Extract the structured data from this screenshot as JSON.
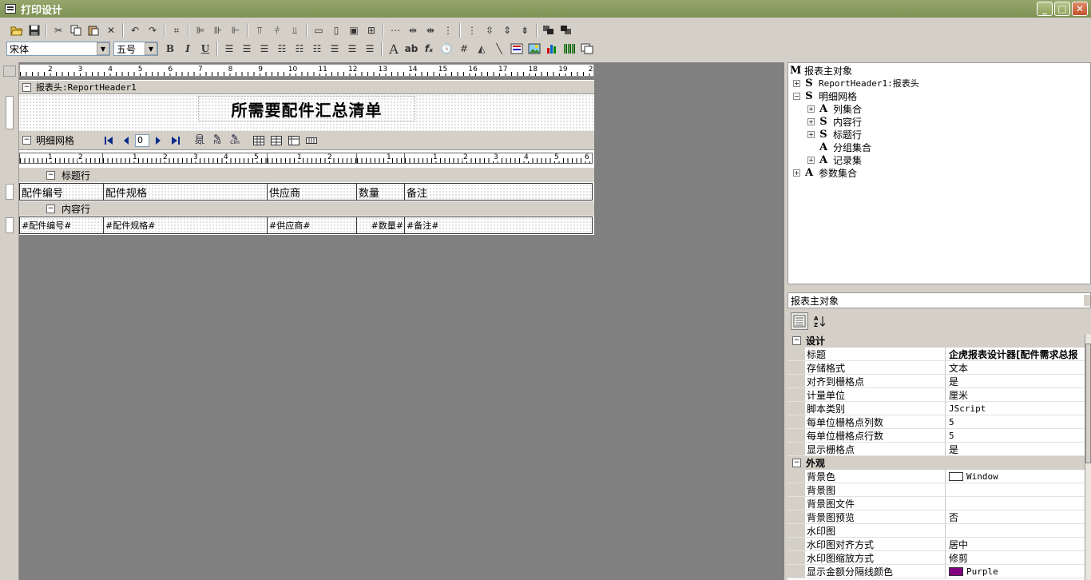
{
  "window": {
    "title": "打印设计"
  },
  "toolbar": {
    "font_name": "宋体",
    "font_size": "五号",
    "bold_label": "B",
    "italic_label": "I",
    "underline_label": "U",
    "text_a_label": "A",
    "ab_label": "ab",
    "fx_label": "fₓ"
  },
  "ruler": {
    "numbers": [
      "2",
      "3",
      "4",
      "5",
      "6",
      "7",
      "8",
      "9",
      "10",
      "11",
      "12",
      "13",
      "14",
      "15",
      "16",
      "17",
      "18",
      "19",
      "2"
    ]
  },
  "report": {
    "header_band_label": "报表头:ReportHeader1",
    "title": "所需要配件汇总清单",
    "grid_band_label": "明细网格",
    "grid_index": "0",
    "title_row_label": "标题行",
    "content_row_label": "内容行",
    "columns": [
      "配件编号",
      "配件规格",
      "供应商",
      "数量",
      "备注"
    ],
    "content_cells": [
      "#配件编号#",
      "#配件规格#",
      "#供应商#",
      "#数量#",
      "#备注#"
    ],
    "grid_btn_labels": [
      "SQL",
      "Fld",
      "Clm"
    ],
    "ruler2": [
      [
        "1",
        "2"
      ],
      [
        "1",
        "2",
        "3",
        "4",
        "5"
      ],
      [
        "1",
        "2"
      ],
      [
        "1"
      ],
      [
        "1",
        "2",
        "3",
        "4",
        "5",
        "6"
      ]
    ]
  },
  "tree": {
    "root": "报表主对象",
    "items": [
      {
        "icon": "S",
        "label": "ReportHeader1:报表头"
      },
      {
        "icon": "S",
        "label": "明细网格"
      },
      {
        "icon": "A",
        "label": "列集合"
      },
      {
        "icon": "S",
        "label": "内容行"
      },
      {
        "icon": "S",
        "label": "标题行"
      },
      {
        "icon": "A",
        "label": "分组集合"
      },
      {
        "icon": "A",
        "label": "记录集"
      },
      {
        "icon": "A",
        "label": "参数集合"
      }
    ],
    "root_icon": "M"
  },
  "properties": {
    "object": "报表主对象",
    "categories": [
      {
        "name": "设计",
        "rows": [
          {
            "name": "标题",
            "value": "企虎报表设计器[配件需求总报"
          },
          {
            "name": "存储格式",
            "value": "文本"
          },
          {
            "name": "对齐到栅格点",
            "value": "是"
          },
          {
            "name": "计量单位",
            "value": "厘米"
          },
          {
            "name": "脚本类别",
            "value": "JScript"
          },
          {
            "name": "每单位栅格点列数",
            "value": "5"
          },
          {
            "name": "每单位栅格点行数",
            "value": "5"
          },
          {
            "name": "显示栅格点",
            "value": "是"
          }
        ]
      },
      {
        "name": "外观",
        "rows": [
          {
            "name": "背景色",
            "value": "Window",
            "swatch": "#ffffff"
          },
          {
            "name": "背景图",
            "value": ""
          },
          {
            "name": "背景图文件",
            "value": ""
          },
          {
            "name": "背景图预览",
            "value": "否"
          },
          {
            "name": "水印图",
            "value": ""
          },
          {
            "name": "水印图对齐方式",
            "value": "居中"
          },
          {
            "name": "水印图缩放方式",
            "value": "修剪"
          },
          {
            "name": "显示金额分隔线颜色",
            "value": "Purple",
            "swatch": "#800080"
          }
        ]
      }
    ]
  },
  "colors": {
    "titlebar": "#8a9c5f",
    "surface": "#808080",
    "chrome": "#d4d0c8"
  }
}
